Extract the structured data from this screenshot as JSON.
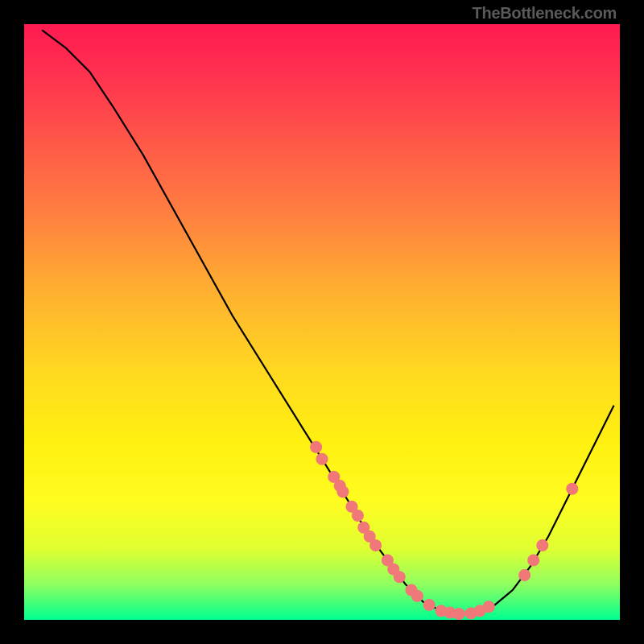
{
  "watermark": "TheBottleneck.com",
  "chart_data": {
    "type": "line",
    "title": "",
    "xlabel": "",
    "ylabel": "",
    "xlim": [
      0,
      100
    ],
    "ylim": [
      0,
      100
    ],
    "curve": [
      {
        "x": 3,
        "y": 99
      },
      {
        "x": 7,
        "y": 96
      },
      {
        "x": 11,
        "y": 92
      },
      {
        "x": 15,
        "y": 86
      },
      {
        "x": 20,
        "y": 78
      },
      {
        "x": 25,
        "y": 69
      },
      {
        "x": 30,
        "y": 60
      },
      {
        "x": 35,
        "y": 51
      },
      {
        "x": 40,
        "y": 43
      },
      {
        "x": 45,
        "y": 35
      },
      {
        "x": 50,
        "y": 27
      },
      {
        "x": 55,
        "y": 19
      },
      {
        "x": 58,
        "y": 14
      },
      {
        "x": 61,
        "y": 10
      },
      {
        "x": 64,
        "y": 6
      },
      {
        "x": 67,
        "y": 3
      },
      {
        "x": 70,
        "y": 1.5
      },
      {
        "x": 73,
        "y": 1
      },
      {
        "x": 76,
        "y": 1.2
      },
      {
        "x": 79,
        "y": 2.5
      },
      {
        "x": 82,
        "y": 5
      },
      {
        "x": 85,
        "y": 9
      },
      {
        "x": 88,
        "y": 14
      },
      {
        "x": 91,
        "y": 20
      },
      {
        "x": 94,
        "y": 26
      },
      {
        "x": 97,
        "y": 32
      },
      {
        "x": 99,
        "y": 36
      }
    ],
    "markers": [
      {
        "x": 49,
        "y": 29
      },
      {
        "x": 50,
        "y": 27
      },
      {
        "x": 52,
        "y": 24
      },
      {
        "x": 53,
        "y": 22.5
      },
      {
        "x": 53.5,
        "y": 21.5
      },
      {
        "x": 55,
        "y": 19
      },
      {
        "x": 56,
        "y": 17.5
      },
      {
        "x": 57,
        "y": 15.5
      },
      {
        "x": 58,
        "y": 14
      },
      {
        "x": 59,
        "y": 12.5
      },
      {
        "x": 61,
        "y": 10
      },
      {
        "x": 62,
        "y": 8.5
      },
      {
        "x": 63,
        "y": 7.2
      },
      {
        "x": 65,
        "y": 5
      },
      {
        "x": 66,
        "y": 4
      },
      {
        "x": 68,
        "y": 2.5
      },
      {
        "x": 70,
        "y": 1.5
      },
      {
        "x": 71.5,
        "y": 1.2
      },
      {
        "x": 73,
        "y": 1
      },
      {
        "x": 75,
        "y": 1.1
      },
      {
        "x": 76.5,
        "y": 1.5
      },
      {
        "x": 78,
        "y": 2.2
      },
      {
        "x": 84,
        "y": 7.5
      },
      {
        "x": 85.5,
        "y": 10
      },
      {
        "x": 87,
        "y": 12.5
      },
      {
        "x": 92,
        "y": 22
      }
    ],
    "marker_color": "#f07878",
    "curve_color": "#000000"
  }
}
